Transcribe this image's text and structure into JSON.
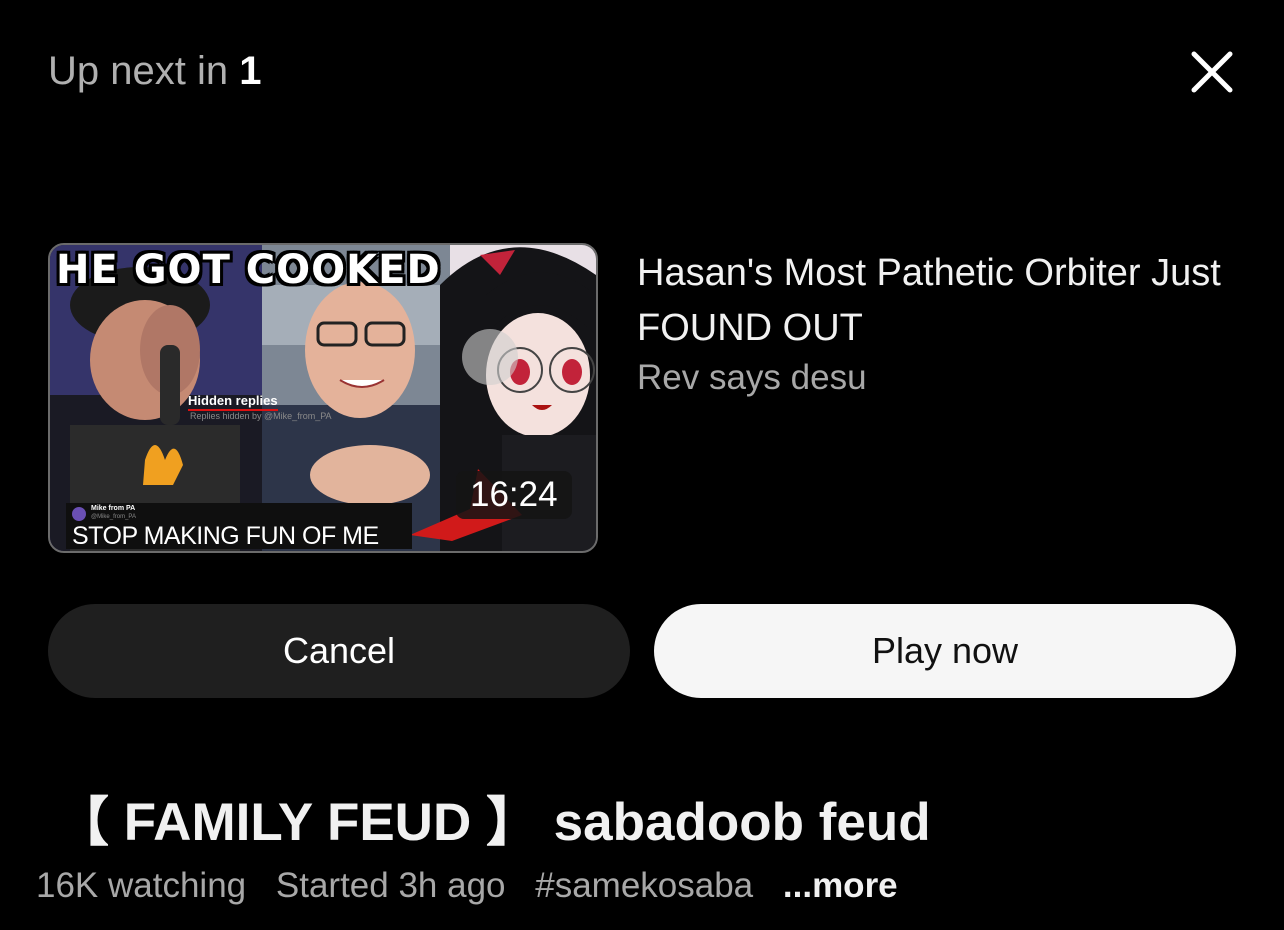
{
  "up_next": {
    "label": "Up next in",
    "countdown": "1"
  },
  "icons": {
    "close": "close-icon"
  },
  "next_video": {
    "thumbnail": {
      "headline": "HE GOT COOKED",
      "hidden_replies": "Hidden replies",
      "hidden_replies_sub": "Replies hidden by @Mike_from_PA",
      "tweet_name": "Mike from PA",
      "tweet_handle": "@Mike_from_PA",
      "tweet_text": "STOP MAKING FUN OF ME",
      "duration": "16:24"
    },
    "title": "Hasan's Most Pathetic Orbiter Just FOUND OUT",
    "channel": "Rev says desu"
  },
  "buttons": {
    "cancel": "Cancel",
    "play_now": "Play now"
  },
  "current_stream": {
    "title": "【 FAMILY FEUD 】 sabadoob feud",
    "watching": "16K watching",
    "started": "Started 3h ago",
    "hashtag": "#samekosaba",
    "more": "...more"
  },
  "colors": {
    "background": "#000000",
    "cancel_bg": "#1f1f1f",
    "play_bg": "#f6f6f6",
    "secondary_text": "#a8a8a8",
    "accent_red": "#d11a1a"
  }
}
